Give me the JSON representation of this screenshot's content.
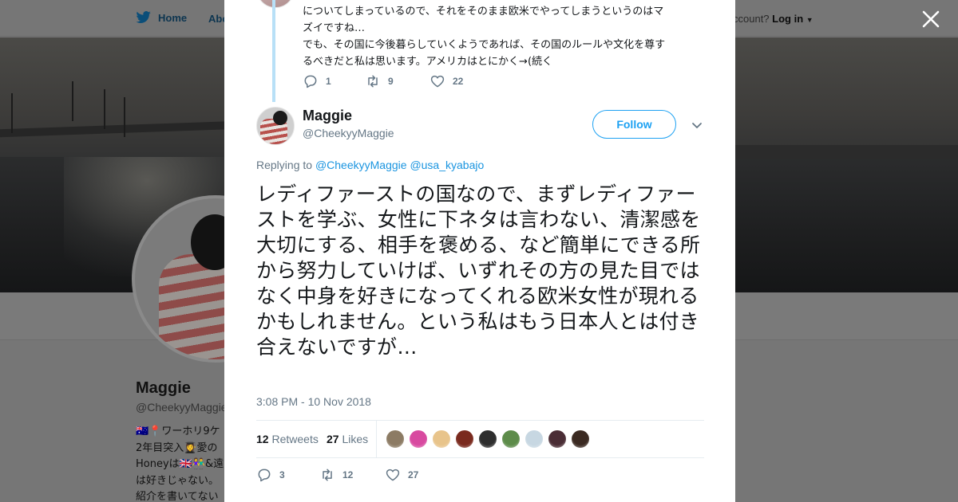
{
  "background": {
    "nav_home": "Home",
    "nav_about": "Abo",
    "account_prompt": "ccount?",
    "login_label": "Log in",
    "profile_name": "Maggie",
    "profile_handle": "@CheekyyMaggie",
    "bio_lines": [
      "🇦🇺📍ワーホリ9ケ",
      "2年目突入👩‍🎓愛の",
      "Honeyは🇬🇧👫&遠",
      "は好きじゃない。",
      "紹介を書いてない"
    ]
  },
  "previous_tweet": {
    "text_lines": [
      "についてしまっているので、それをそのまま欧米でやってしまうというのはマ",
      "ズイですね…",
      "でも、その国に今後暮らしていくようであれば、その国のルールや文化を尊す",
      "るべきだと私は思います。アメリカはとにかく→(続く"
    ],
    "reply_count": "1",
    "retweet_count": "9",
    "like_count": "22"
  },
  "tweet": {
    "author_name": "Maggie",
    "author_handle": "@CheekyyMaggie",
    "follow_label": "Follow",
    "replying_label": "Replying to",
    "replying_to": [
      "@CheekyyMaggie",
      "@usa_kyabajo"
    ],
    "text": "レディファーストの国なので、まずレディファーストを学ぶ、女性に下ネタは言わない、清潔感を大切にする、相手を褒める、など簡単にできる所から努力していけば、いずれその方の見た目ではなく中身を好きになってくれる欧米女性が現れるかもしれません。という私はもう日本人とは付き合えないですが…",
    "timestamp": "3:08 PM - 10 Nov 2018",
    "retweets_count": "12",
    "retweets_label": "Retweets",
    "likes_count": "27",
    "likes_label": "Likes",
    "reply_count": "3",
    "retweet_count": "12",
    "like_count": "27"
  },
  "likers": [
    {
      "color": "#8c7b64"
    },
    {
      "color": "#d84aa0"
    },
    {
      "color": "#e8c48b"
    },
    {
      "color": "#7a2a1e"
    },
    {
      "color": "#2e2e2e"
    },
    {
      "color": "#5d8c4a"
    },
    {
      "color": "#c7d7e2"
    },
    {
      "color": "#4a2d35"
    },
    {
      "color": "#3b2a22"
    }
  ],
  "colors": {
    "accent": "#1da1f2",
    "link": "#1b95e0",
    "muted": "#657786",
    "text": "#14171a",
    "thread_line": "#b8e0f7"
  }
}
